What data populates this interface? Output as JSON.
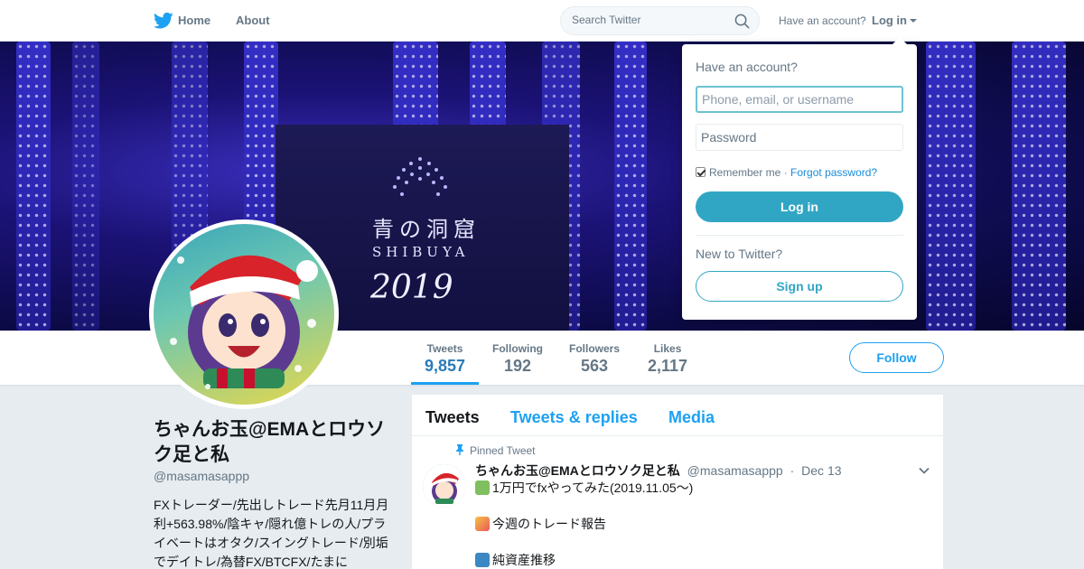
{
  "nav": {
    "home_label": "Home",
    "about_label": "About",
    "search_placeholder": "Search Twitter",
    "have_account": "Have an account?",
    "login_label": "Log in"
  },
  "banner": {
    "sign_title": "青の洞窟",
    "sign_subtitle": "SHIBUYA",
    "sign_year": "2019"
  },
  "stats": [
    {
      "label": "Tweets",
      "value": "9,857",
      "active": true
    },
    {
      "label": "Following",
      "value": "192",
      "active": false
    },
    {
      "label": "Followers",
      "value": "563",
      "active": false
    },
    {
      "label": "Likes",
      "value": "2,117",
      "active": false
    }
  ],
  "follow_label": "Follow",
  "profile": {
    "display_name": "ちゃんお玉@EMAとロウソク足と私",
    "screen_name": "@masamasappp",
    "bio": "FXトレーダー/先出しトレード先月11月月利+563.98%/陰キャ/隠れ億トレの人/プライベートはオタク/スイングトレード/別垢でデイトレ/為替FX/BTCFX/たまに"
  },
  "timeline": {
    "tabs": [
      "Tweets",
      "Tweets & replies",
      "Media"
    ],
    "pinned_label": "Pinned Tweet",
    "tweet": {
      "name": "ちゃんお玉@EMAとロウソク足と私",
      "handle": "@masamasappp",
      "separator": "·",
      "date": "Dec 13",
      "lines": [
        "1万円でfxやってみた(2019.11.05〜)",
        "",
        "今週のトレード報告",
        "",
        "純資産推移"
      ]
    }
  },
  "login_dropdown": {
    "title": "Have an account?",
    "username_placeholder": "Phone, email, or username",
    "password_placeholder": "Password",
    "remember_label": "Remember me",
    "separator": "·",
    "forgot_label": "Forgot password?",
    "login_button": "Log in",
    "new_prompt": "New to Twitter?",
    "signup_button": "Sign up"
  },
  "colors": {
    "accent": "#1da1f2",
    "login_button": "#31a6c4",
    "muted_text": "#657786",
    "page_background": "#e6ecf0"
  },
  "icons": [
    "twitter-bird-icon",
    "search-icon",
    "pin-icon",
    "chevron-down-icon",
    "money-emoji-icon",
    "party-emoji-icon",
    "checkbox-emoji-icon"
  ]
}
